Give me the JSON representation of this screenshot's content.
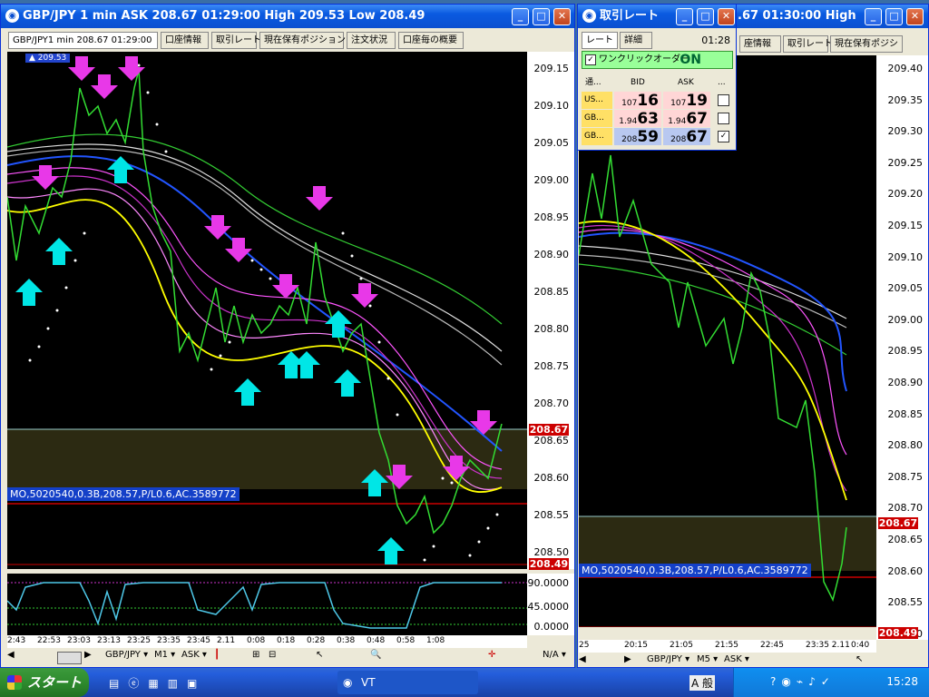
{
  "main_window": {
    "title": "GBP/JPY 1 min ASK 208.67 01:29:00 High 209.53 Low 208.49",
    "tabs": [
      "GBP/JPY1 min 208.67 01:29:00",
      "口座情報",
      "取引レート",
      "現在保有ポジション",
      "注文状況",
      "口座毎の概要"
    ],
    "badge": "209.53",
    "y_ticks": [
      "209.15",
      "209.10",
      "209.05",
      "209.00",
      "208.95",
      "208.90",
      "208.85",
      "208.80",
      "208.75",
      "208.70",
      "208.65",
      "208.60",
      "208.55",
      "208.50"
    ],
    "current_price": "208.67",
    "low_price": "208.49",
    "position_label": "MO,5020540,0.3B,208.57,P/L0.6,AC.3589772",
    "osc_ticks": [
      "90.0000",
      "45.0000",
      "0.0000"
    ],
    "x_ticks": [
      "2:43",
      "22:53",
      "23:03",
      "23:13",
      "23:25",
      "23:35",
      "23:45",
      "2.11",
      "0:08",
      "0:18",
      "0:28",
      "0:38",
      "0:48",
      "0:58",
      "1:08"
    ],
    "toolbar": {
      "pair": "GBP/JPY",
      "timeframe": "M1",
      "side": "ASK",
      "na": "N/A"
    }
  },
  "rate_window": {
    "title": "取引レート",
    "tabs": [
      "レート",
      "詳細"
    ],
    "time": "01:28",
    "oneclick_label": "ワンクリックオーダー",
    "oneclick_state": "ON",
    "headers": [
      "通...",
      "BID",
      "ASK",
      "..."
    ],
    "rows": [
      {
        "pair": "US...",
        "bid_small": "107",
        "bid_big": "16",
        "ask_small": "107",
        "ask_big": "19",
        "checked": false
      },
      {
        "pair": "GB...",
        "bid_small": "1.94",
        "bid_big": "63",
        "ask_small": "1.94",
        "ask_big": "67",
        "checked": false
      },
      {
        "pair": "GB...",
        "bid_small": "208",
        "bid_big": "59",
        "ask_small": "208",
        "ask_big": "67",
        "checked": true
      }
    ]
  },
  "second_window": {
    "title": ".67 01:30:00 High",
    "tabs": [
      "座情報",
      "取引レート",
      "現在保有ポジシ"
    ],
    "y_ticks": [
      "209.40",
      "209.35",
      "209.30",
      "209.25",
      "209.20",
      "209.15",
      "209.10",
      "209.05",
      "209.00",
      "208.95",
      "208.90",
      "208.85",
      "208.80",
      "208.75",
      "208.70",
      "208.65",
      "208.60",
      "208.55",
      "208.50"
    ],
    "current_price": "208.67",
    "low_price": "208.49",
    "position_label": "MO,5020540,0.3B,208.57,P/L0.6,AC.3589772",
    "x_ticks": [
      "25",
      "20:15",
      "21:05",
      "21:55",
      "22:45",
      "23:35 2.11",
      "0:40"
    ],
    "toolbar": {
      "pair": "GBP/JPY",
      "timeframe": "M5",
      "side": "ASK"
    }
  },
  "taskbar": {
    "start": "スタート",
    "task": "VT",
    "ime": "A 般",
    "clock": "15:28"
  },
  "colors": {
    "magenta": "#e838e8",
    "cyan": "#00e6e6",
    "green": "#33dd33",
    "yellow": "#ffff00",
    "blue": "#2255ff",
    "red": "#cc0000"
  }
}
